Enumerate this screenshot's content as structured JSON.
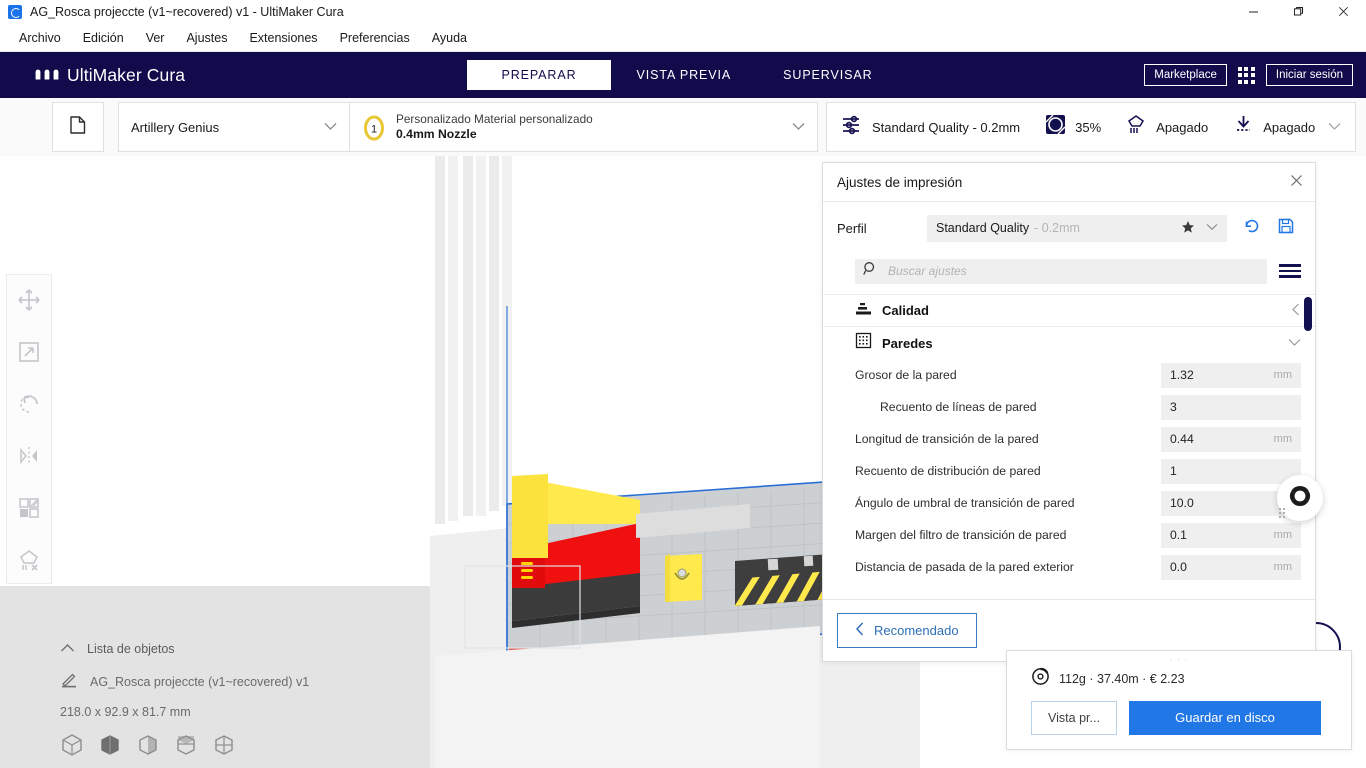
{
  "window": {
    "title": "AG_Rosca projeccte (v1~recovered) v1 - UltiMaker Cura",
    "app_icon": "cura-app-icon",
    "minimize": "—",
    "maximize": "❐",
    "close": "✕"
  },
  "menu": {
    "items": [
      "Archivo",
      "Edición",
      "Ver",
      "Ajustes",
      "Extensiones",
      "Preferencias",
      "Ayuda"
    ]
  },
  "header": {
    "brand": "UltiMaker Cura",
    "stages": [
      {
        "label": "PREPARAR",
        "active": true
      },
      {
        "label": "VISTA PREVIA",
        "active": false
      },
      {
        "label": "SUPERVISAR",
        "active": false
      }
    ],
    "marketplace": "Marketplace",
    "signin": "Iniciar sesión",
    "accent": "#110b4c"
  },
  "configbar": {
    "open_file_icon": "folder-open-icon",
    "printer": "Artillery Genius",
    "material_top": "Personalizado Material personalizado",
    "material_bottom": "0.4mm Nozzle",
    "extruder_number": "1",
    "quality_profile": "Standard Quality - 0.2mm",
    "infill": "35%",
    "support": "Apagado",
    "adhesion": "Apagado"
  },
  "left_toolbar": {
    "tools": [
      {
        "name": "move-tool",
        "glyph": "move-icon"
      },
      {
        "name": "scale-tool",
        "glyph": "scale-icon"
      },
      {
        "name": "rotate-tool",
        "glyph": "rotate-icon"
      },
      {
        "name": "mirror-tool",
        "glyph": "mirror-icon"
      },
      {
        "name": "per-model-settings-tool",
        "glyph": "per-model-icon"
      },
      {
        "name": "support-blocker-tool",
        "glyph": "support-blocker-icon"
      }
    ]
  },
  "object_list": {
    "header": "Lista de objetos",
    "object_name": "AG_Rosca projeccte (v1~recovered) v1",
    "dimensions": "218.0 x 92.9 x 81.7 mm",
    "view_modes": [
      "solid-view-icon",
      "xray-view-icon",
      "layer-view-icon",
      "shell-view-icon",
      "compat-view-icon"
    ]
  },
  "print_settings": {
    "title": "Ajustes de impresión",
    "close": "✕",
    "profile_label": "Perfil",
    "profile_name": "Standard Quality",
    "profile_layer": "- 0.2mm",
    "star_icon": "star-icon",
    "reset_icon": "reset-icon",
    "save_icon": "save-icon",
    "search_placeholder": "Buscar ajustes",
    "search_value": "",
    "menu_icon": "settings-visibility-icon",
    "categories": [
      {
        "name": "Calidad",
        "icon": "quality-icon",
        "expanded": false,
        "arrow": "‹"
      },
      {
        "name": "Paredes",
        "icon": "walls-icon",
        "expanded": true,
        "arrow": "⌄"
      }
    ],
    "settings": [
      {
        "label": "Grosor de la pared",
        "value": "1.32",
        "unit": "mm",
        "indent": false
      },
      {
        "label": "Recuento de líneas de pared",
        "value": "3",
        "unit": "",
        "indent": true
      },
      {
        "label": "Longitud de transición de la pared",
        "value": "0.44",
        "unit": "mm",
        "indent": false
      },
      {
        "label": "Recuento de distribución de pared",
        "value": "1",
        "unit": "",
        "indent": false
      },
      {
        "label": "Ángulo de umbral de transición de pared",
        "value": "10.0",
        "unit": "°",
        "indent": false
      },
      {
        "label": "Margen del filtro de transición de pared",
        "value": "0.1",
        "unit": "mm",
        "indent": false
      },
      {
        "label": "Distancia de pasada de la pared exterior",
        "value": "0.0",
        "unit": "mm",
        "indent": false
      }
    ],
    "recommended_button": "Recomendado",
    "recommended_arrow": "‹"
  },
  "action_panel": {
    "cost_icon": "spool-icon",
    "cost_text": "112g · 37.40m · € 2.23",
    "preview_button": "Vista pr...",
    "save_button": "Guardar en disco",
    "primary_color": "#2277e6"
  }
}
